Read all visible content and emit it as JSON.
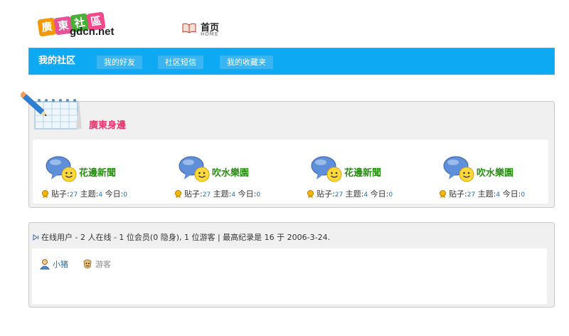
{
  "site": {
    "logo_chars": [
      "廣",
      "東",
      "社",
      "區"
    ],
    "domain": "gdcn.net",
    "colors": {
      "logo1": "#f39800",
      "logo2": "#e85298",
      "logo3": "#46b035",
      "logo4": "#f14a8c"
    }
  },
  "home": {
    "label": "首页",
    "sub": "HOME",
    "icon": "book-icon"
  },
  "nav": {
    "active_label": "我的社区",
    "tabs": [
      {
        "label": "我的好友"
      },
      {
        "label": "社区短信"
      },
      {
        "label": "我的收藏夹"
      }
    ]
  },
  "section": {
    "title": "廣東身邊",
    "icon": "calendar-pencil-icon"
  },
  "forums": [
    {
      "name": "花邊新聞",
      "posts_label": "贴子:",
      "posts": "27",
      "topics_label": "主题:",
      "topics": "4",
      "today_label": "今日:",
      "today": "0"
    },
    {
      "name": "吹水樂園",
      "posts_label": "贴子:",
      "posts": "27",
      "topics_label": "主题:",
      "topics": "4",
      "today_label": "今日:",
      "today": "0"
    },
    {
      "name": "花邊新聞",
      "posts_label": "贴子:",
      "posts": "27",
      "topics_label": "主题:",
      "topics": "4",
      "today_label": "今日:",
      "today": "0"
    },
    {
      "name": "吹水樂園",
      "posts_label": "贴子:",
      "posts": "27",
      "topics_label": "主题:",
      "topics": "4",
      "today_label": "今日:",
      "today": "0"
    }
  ],
  "online": {
    "summary": "在线用户 - 2 人在线 - 1 位会员(0 隐身), 1 位游客 | 最高纪录是 16 于 2006-3-24.",
    "users": [
      {
        "name": "小猪",
        "icon": "member-icon",
        "color": "#1e6fc0"
      },
      {
        "name": "游客",
        "icon": "guest-icon",
        "color": "#888888"
      }
    ]
  }
}
